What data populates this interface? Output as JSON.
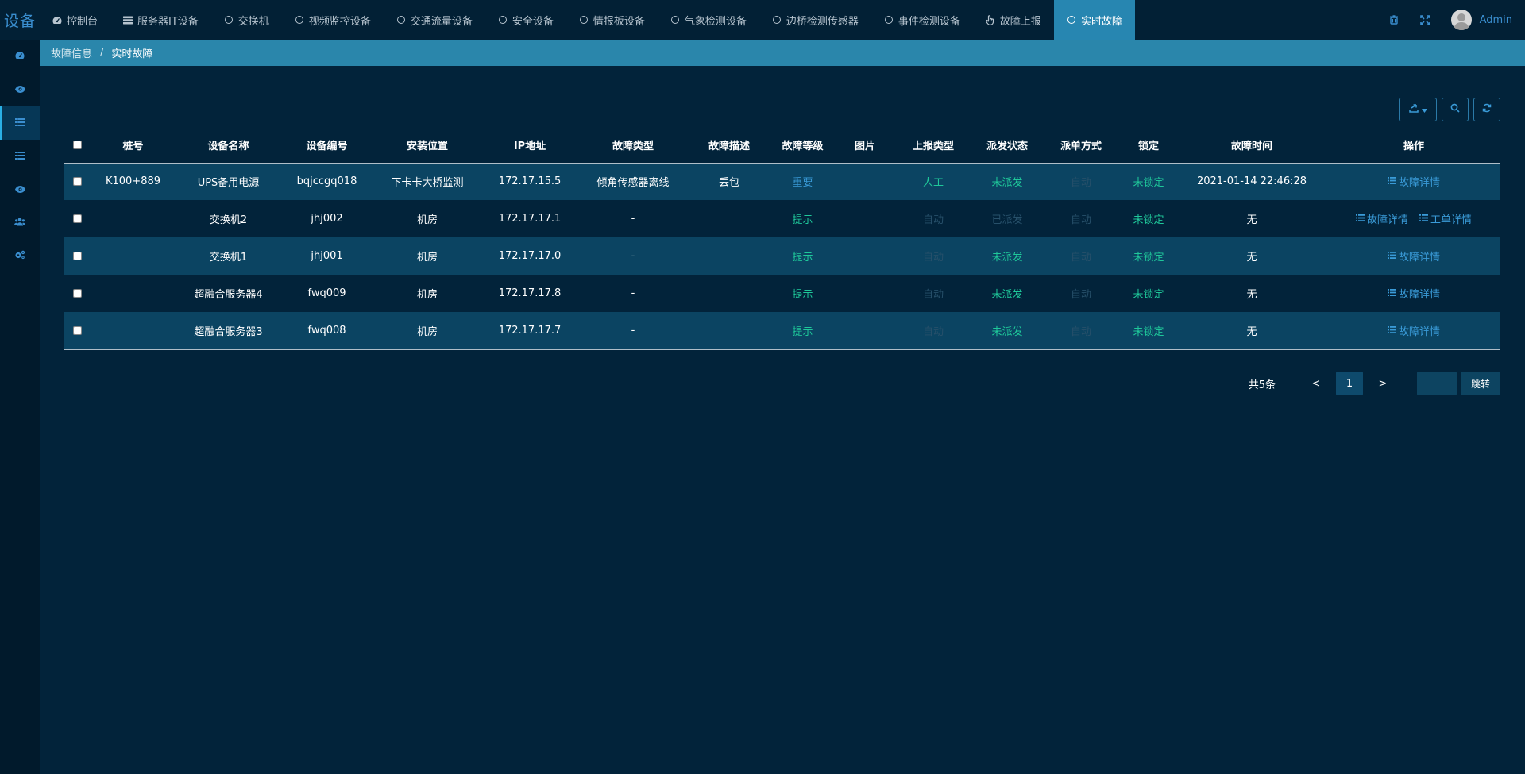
{
  "brand": "设备",
  "nav": {
    "tabs": [
      {
        "label": "控制台",
        "icon": "dashboard-icon"
      },
      {
        "label": "服务器IT设备",
        "icon": "server-icon"
      },
      {
        "label": "交换机",
        "icon": "circle-icon"
      },
      {
        "label": "视频监控设备",
        "icon": "circle-icon"
      },
      {
        "label": "交通流量设备",
        "icon": "circle-icon"
      },
      {
        "label": "安全设备",
        "icon": "circle-icon"
      },
      {
        "label": "情报板设备",
        "icon": "circle-icon"
      },
      {
        "label": "气象检测设备",
        "icon": "circle-icon"
      },
      {
        "label": "边桥检测传感器",
        "icon": "circle-icon"
      },
      {
        "label": "事件检测设备",
        "icon": "circle-icon"
      },
      {
        "label": "故障上报",
        "icon": "hand-pointer-icon"
      },
      {
        "label": "实时故障",
        "icon": "circle-icon",
        "active": true
      }
    ],
    "user": "Admin"
  },
  "sidebar": {
    "items": [
      {
        "icon": "dashboard-icon"
      },
      {
        "icon": "eye-icon"
      },
      {
        "icon": "list-icon",
        "active": true
      },
      {
        "icon": "list-icon"
      },
      {
        "icon": "eye-icon"
      },
      {
        "icon": "users-icon"
      },
      {
        "icon": "cogs-icon"
      }
    ]
  },
  "breadcrumb": {
    "items": [
      "故障信息",
      "实时故障"
    ],
    "separator": "/"
  },
  "table": {
    "columns": [
      "桩号",
      "设备名称",
      "设备编号",
      "安装位置",
      "IP地址",
      "故障类型",
      "故障描述",
      "故障等级",
      "图片",
      "上报类型",
      "派发状态",
      "派单方式",
      "锁定",
      "故障时间",
      "操作"
    ],
    "rows": [
      {
        "pile": "K100+889",
        "name": "UPS备用电源",
        "code": "bqjccgq018",
        "location": "下卡卡大桥监测",
        "ip": "172.17.15.5",
        "fault_type": "倾角传感器离线",
        "fault_desc": "丢包",
        "level": "重要",
        "level_kind": "important",
        "image": "",
        "report_type": "人工",
        "report_dim": false,
        "dispatch_status": "未派发",
        "dispatch_dim": false,
        "dispatch_method": "自动",
        "method_dim": true,
        "lock": "未锁定",
        "time": "2021-01-14 22:46:28",
        "actions": [
          "故障详情"
        ]
      },
      {
        "pile": "",
        "name": "交换机2",
        "code": "jhj002",
        "location": "机房",
        "ip": "172.17.17.1",
        "fault_type": "-",
        "fault_desc": "",
        "level": "提示",
        "level_kind": "tip",
        "image": "",
        "report_type": "自动",
        "report_dim": true,
        "dispatch_status": "已派发",
        "dispatch_dim": true,
        "dispatch_method": "自动",
        "method_dim": true,
        "lock": "未锁定",
        "time": "无",
        "actions": [
          "故障详情",
          "工单详情"
        ]
      },
      {
        "pile": "",
        "name": "交换机1",
        "code": "jhj001",
        "location": "机房",
        "ip": "172.17.17.0",
        "fault_type": "-",
        "fault_desc": "",
        "level": "提示",
        "level_kind": "tip",
        "image": "",
        "report_type": "自动",
        "report_dim": true,
        "dispatch_status": "未派发",
        "dispatch_dim": false,
        "dispatch_method": "自动",
        "method_dim": true,
        "lock": "未锁定",
        "time": "无",
        "actions": [
          "故障详情"
        ]
      },
      {
        "pile": "",
        "name": "超融合服务器4",
        "code": "fwq009",
        "location": "机房",
        "ip": "172.17.17.8",
        "fault_type": "-",
        "fault_desc": "",
        "level": "提示",
        "level_kind": "tip",
        "image": "",
        "report_type": "自动",
        "report_dim": true,
        "dispatch_status": "未派发",
        "dispatch_dim": false,
        "dispatch_method": "自动",
        "method_dim": true,
        "lock": "未锁定",
        "time": "无",
        "actions": [
          "故障详情"
        ]
      },
      {
        "pile": "",
        "name": "超融合服务器3",
        "code": "fwq008",
        "location": "机房",
        "ip": "172.17.17.7",
        "fault_type": "-",
        "fault_desc": "",
        "level": "提示",
        "level_kind": "tip",
        "image": "",
        "report_type": "自动",
        "report_dim": true,
        "dispatch_status": "未派发",
        "dispatch_dim": false,
        "dispatch_method": "自动",
        "method_dim": true,
        "lock": "未锁定",
        "time": "无",
        "actions": [
          "故障详情"
        ]
      }
    ]
  },
  "pagination": {
    "total": "共5条",
    "prev": "<",
    "current": "1",
    "next": ">",
    "jump_value": "",
    "jump_label": "跳转"
  },
  "colors": {
    "accent": "#2786b1",
    "link": "#3a9bd8",
    "ok": "#1fc89a",
    "background": "#02233a"
  }
}
